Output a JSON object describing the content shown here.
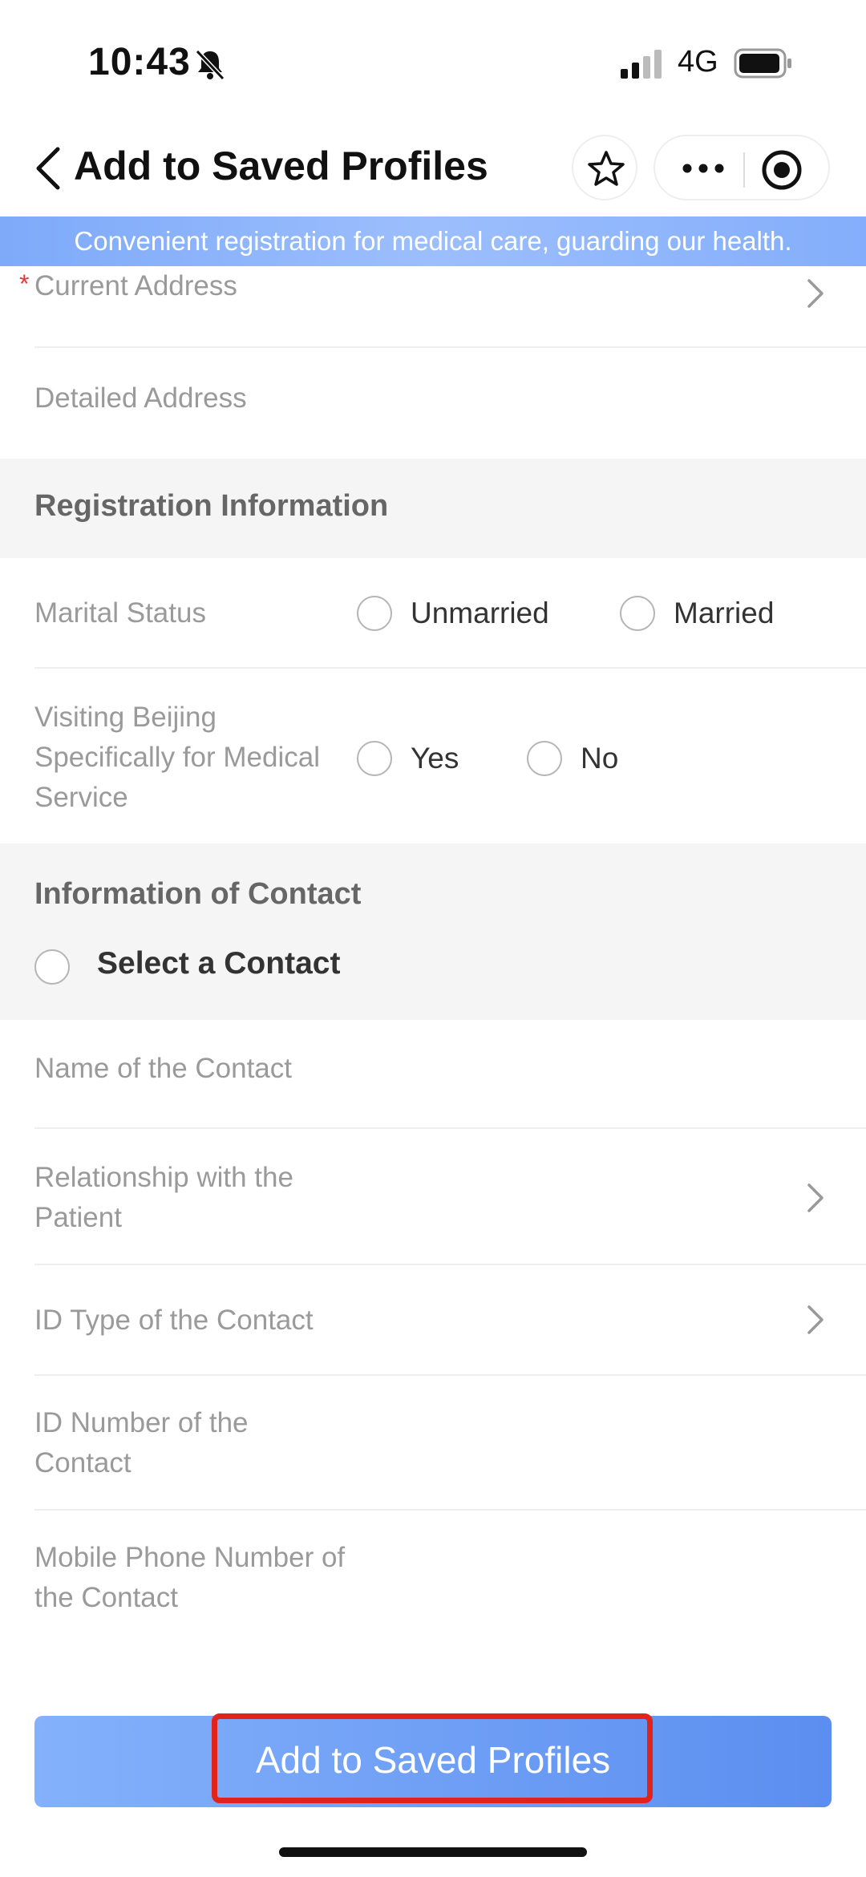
{
  "status_bar": {
    "time": "10:43",
    "network": "4G"
  },
  "nav": {
    "title": "Add to Saved Profiles"
  },
  "banner": {
    "text": "Convenient registration for medical care, guarding our health."
  },
  "address": {
    "required_mark": "*",
    "current_address_label": "Current Address",
    "detailed_address_label": "Detailed Address"
  },
  "registration": {
    "section_title": "Registration Information",
    "marital_status_label": "Marital Status",
    "marital_options": [
      "Unmarried",
      "Married"
    ],
    "visiting_label": "Visiting Beijing Specifically for Medical Service",
    "visiting_options": [
      "Yes",
      "No"
    ]
  },
  "contact": {
    "section_title": "Information of Contact",
    "select_contact_label": "Select a Contact",
    "name_label": "Name of the Contact",
    "relationship_label": "Relationship with the Patient",
    "id_type_label": "ID Type of the Contact",
    "id_number_label": "ID Number of the Contact",
    "mobile_label": "Mobile Phone Number of the Contact"
  },
  "submit": {
    "label": "Add to Saved Profiles"
  },
  "colors": {
    "accent": "#5b8ef0",
    "banner": "#8db4fb",
    "required": "#e23b3b",
    "highlight": "#e0241b"
  }
}
